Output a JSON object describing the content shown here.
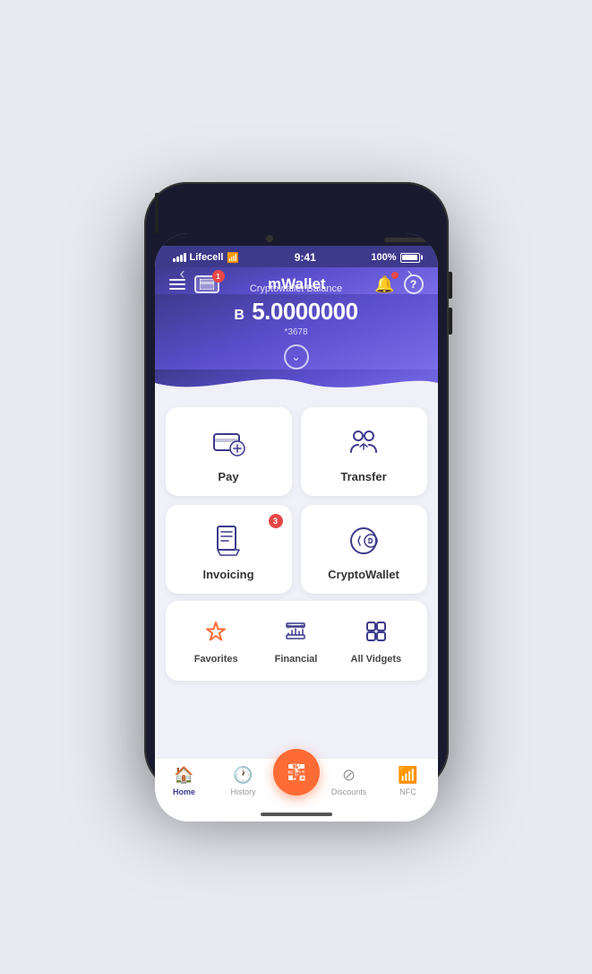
{
  "statusBar": {
    "carrier": "Lifecell",
    "time": "9:41",
    "battery": "100%"
  },
  "header": {
    "title": "mWallet"
  },
  "balance": {
    "label": "Cryptowallet Balance",
    "symbol": "B",
    "amount": "5.0000000",
    "account": "*3678"
  },
  "actions": [
    {
      "id": "pay",
      "label": "Pay",
      "badge": null
    },
    {
      "id": "transfer",
      "label": "Transfer",
      "badge": null
    },
    {
      "id": "invoicing",
      "label": "Invoicing",
      "badge": "3"
    },
    {
      "id": "cryptowallet",
      "label": "CryptoWallet",
      "badge": null
    }
  ],
  "widgets": [
    {
      "id": "favorites",
      "label": "Favorites"
    },
    {
      "id": "financial",
      "label": "Financial"
    },
    {
      "id": "all-vidgets",
      "label": "All Vidgets"
    }
  ],
  "bottomNav": [
    {
      "id": "home",
      "label": "Home",
      "active": true
    },
    {
      "id": "history",
      "label": "History",
      "active": false
    },
    {
      "id": "scan",
      "label": "",
      "active": false,
      "isCenter": true
    },
    {
      "id": "discounts",
      "label": "Discounts",
      "active": false
    },
    {
      "id": "nfc",
      "label": "NFC",
      "active": false
    }
  ]
}
